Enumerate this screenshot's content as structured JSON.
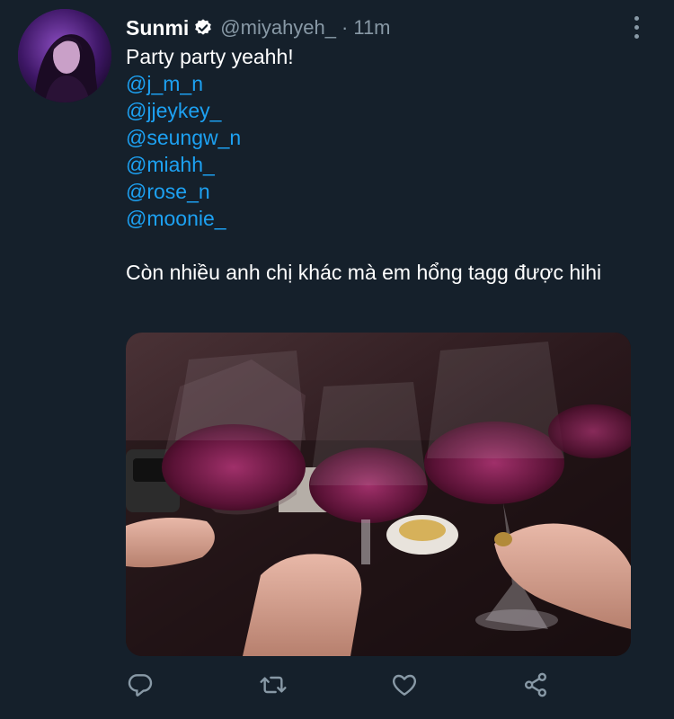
{
  "tweet": {
    "author_name": "Sunmi",
    "handle": "@miyahyeh_",
    "separator": "·",
    "time": "11m",
    "text_first": "Party party yeahh!",
    "mentions": [
      "@j_m_n",
      "@jjeykey_",
      "@seungw_n",
      "@miahh_",
      "@rose_n",
      "@moonie_"
    ],
    "text_second": "Còn nhiều anh chị khác mà em hổng tagg được hihi"
  },
  "icons": {
    "verified": "verified-badge-icon",
    "more": "more-options-icon",
    "reply": "reply-icon",
    "retweet": "retweet-icon",
    "like": "heart-icon",
    "share": "share-icon"
  },
  "colors": {
    "background": "#15202b",
    "text": "#ffffff",
    "secondary": "#8899a6",
    "link": "#1da1f2"
  }
}
